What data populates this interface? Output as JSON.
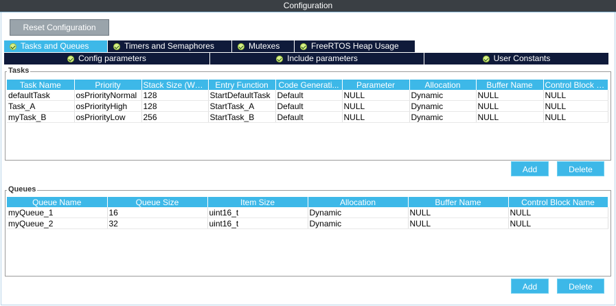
{
  "window": {
    "title": "Configuration"
  },
  "toolbar": {
    "reset_label": "Reset Configuration"
  },
  "tabs_row1": [
    {
      "label": "Tasks and Queues",
      "active": true
    },
    {
      "label": "Timers and Semaphores",
      "active": false
    },
    {
      "label": "Mutexes",
      "active": false
    },
    {
      "label": "FreeRTOS Heap Usage",
      "active": false
    }
  ],
  "tabs_row2": [
    {
      "label": "Config parameters"
    },
    {
      "label": "Include parameters"
    },
    {
      "label": "User Constants"
    }
  ],
  "tasks": {
    "group_label": "Tasks",
    "columns": [
      "Task Name",
      "Priority",
      "Stack Size (Wor...",
      "Entry Function",
      "Code Generati...",
      "Parameter",
      "Allocation",
      "Buffer Name",
      "Control Block N..."
    ],
    "rows": [
      [
        "defaultTask",
        "osPriorityNormal",
        "128",
        "StartDefaultTask",
        "Default",
        "NULL",
        "Dynamic",
        "NULL",
        "NULL"
      ],
      [
        "Task_A",
        "osPriorityHigh",
        "128",
        "StartTask_A",
        "Default",
        "NULL",
        "Dynamic",
        "NULL",
        "NULL"
      ],
      [
        "myTask_B",
        "osPriorityLow",
        "256",
        "StartTask_B",
        "Default",
        "NULL",
        "Dynamic",
        "NULL",
        "NULL"
      ]
    ],
    "add_label": "Add",
    "delete_label": "Delete"
  },
  "queues": {
    "group_label": "Queues",
    "columns": [
      "Queue Name",
      "Queue Size",
      "Item Size",
      "Allocation",
      "Buffer Name",
      "Control Block Name"
    ],
    "rows": [
      [
        "myQueue_1",
        "16",
        "uint16_t",
        "Dynamic",
        "NULL",
        "NULL"
      ],
      [
        "myQueue_2",
        "32",
        "uint16_t",
        "Dynamic",
        "NULL",
        "NULL"
      ]
    ],
    "add_label": "Add",
    "delete_label": "Delete"
  },
  "colors": {
    "accent": "#3db8e8",
    "tab_dark": "#0f1a3a",
    "titlebar": "#3a3f44",
    "check": "#d8f08a"
  }
}
